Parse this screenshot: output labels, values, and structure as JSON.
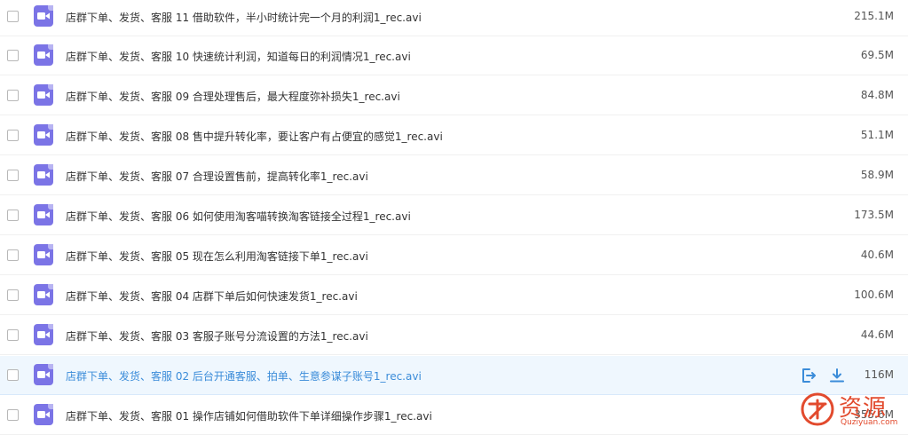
{
  "files": [
    {
      "name": "店群下单、发货、客服 11 借助软件，半小时统计完一个月的利润1_rec.avi",
      "size": "215.1M"
    },
    {
      "name": "店群下单、发货、客服 10 快速统计利润，知道每日的利润情况1_rec.avi",
      "size": "69.5M"
    },
    {
      "name": "店群下单、发货、客服 09 合理处理售后，最大程度弥补损失1_rec.avi",
      "size": "84.8M"
    },
    {
      "name": "店群下单、发货、客服 08 售中提升转化率，要让客户有占便宜的感觉1_rec.avi",
      "size": "51.1M"
    },
    {
      "name": "店群下单、发货、客服 07 合理设置售前，提高转化率1_rec.avi",
      "size": "58.9M"
    },
    {
      "name": "店群下单、发货、客服 06 如何使用淘客喵转换淘客链接全过程1_rec.avi",
      "size": "173.5M"
    },
    {
      "name": "店群下单、发货、客服 05 现在怎么利用淘客链接下单1_rec.avi",
      "size": "40.6M"
    },
    {
      "name": "店群下单、发货、客服 04 店群下单后如何快速发货1_rec.avi",
      "size": "100.6M"
    },
    {
      "name": "店群下单、发货、客服 03 客服子账号分流设置的方法1_rec.avi",
      "size": "44.6M"
    },
    {
      "name": "店群下单、发货、客服 02 后台开通客服、拍单、生意参谋子账号1_rec.avi",
      "size": "116M"
    },
    {
      "name": "店群下单、发货、客服 01 操作店铺如何借助软件下单详细操作步骤1_rec.avi",
      "size": "355.6M"
    }
  ],
  "highlighted_index": 9,
  "row_actions": {
    "share_icon": "share-icon",
    "download_icon": "download-icon"
  },
  "colors": {
    "accent": "#3b8cd9",
    "file_icon": "#7b74e6",
    "highlight_bg": "#eff7fe",
    "watermark": "#e24a2d"
  },
  "watermark": {
    "main": "资源",
    "sub": "Quziyuan.com"
  }
}
